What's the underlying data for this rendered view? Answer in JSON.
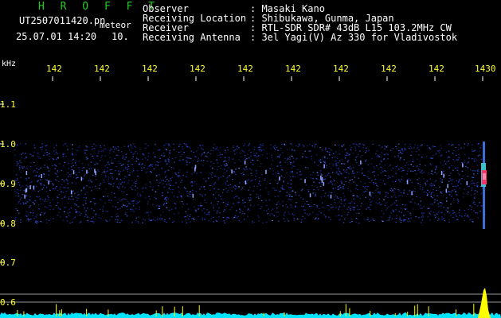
{
  "header": {
    "brand": "H R O F F T",
    "filename": "UT2507011420.pn",
    "mode_label": "meteor",
    "datetime": "25.07.01 14:20",
    "count": "10.",
    "observer_label": "Observer",
    "observer_value": ": Masaki Kano",
    "location_label": "Receiving Location",
    "location_value": ": Shibukawa, Gunma, Japan",
    "receiver_label": "Receiver",
    "receiver_value": ": RTL-SDR SDR# 43dB L15 103.2MHz CW",
    "antenna_label": "Receiving Antenna",
    "antenna_value": ": 3el Yagi(V) Az 330 for Vladivostok"
  },
  "axis": {
    "y_unit": "kHz",
    "y_ticks": [
      "1.1",
      "1.0",
      "0.9",
      "0.8",
      "0.7",
      "0.6"
    ],
    "x_ticks": [
      "142",
      "142",
      "142",
      "142",
      "142",
      "142",
      "142",
      "142",
      "142",
      "1430"
    ]
  },
  "colors": {
    "background": "#000000",
    "noise": "#2233aa",
    "signal": "#ffff00",
    "hot": "#ff3366",
    "baseline": "#00e5ff"
  }
}
